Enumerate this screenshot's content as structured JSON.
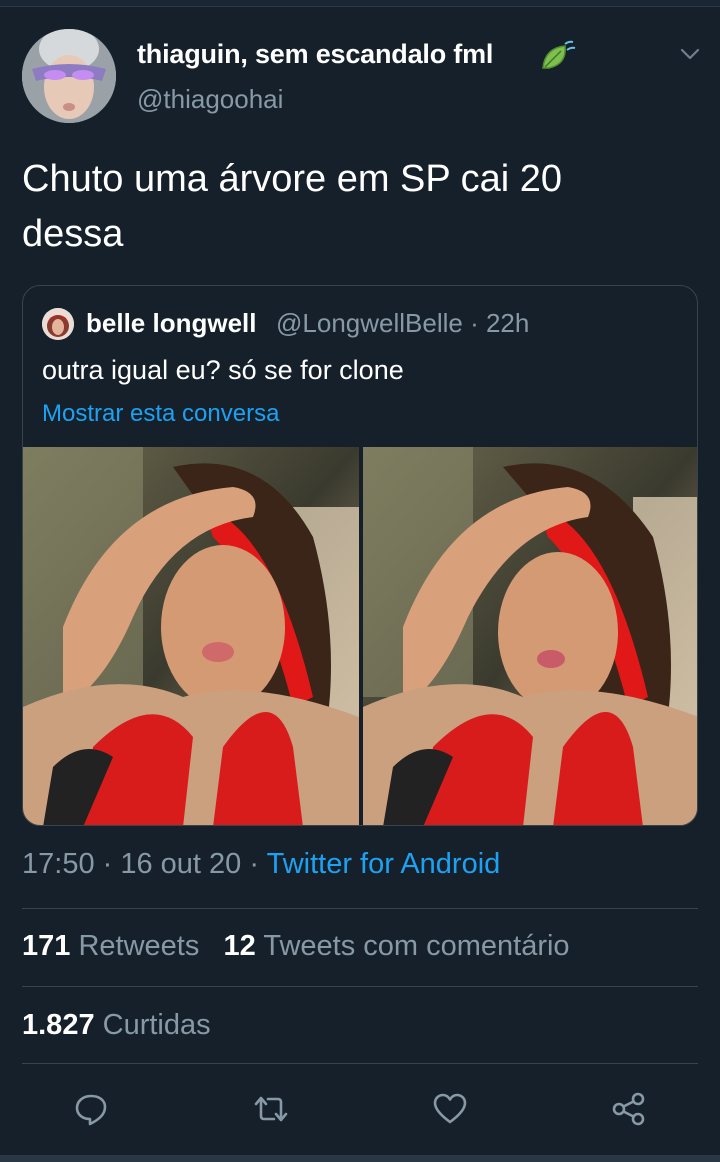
{
  "tweet": {
    "author_name": "thiaguin, sem escandalo fml",
    "author_handle": "@thiagoohai",
    "text": "Chuto uma árvore em SP cai 20 dessa",
    "time": "17:50",
    "date": "16 out 20",
    "source": "Twitter for Android",
    "retweets_count": "171",
    "retweets_label": "Retweets",
    "quotes_count": "12",
    "quotes_label": "Tweets com comentário",
    "likes_count": "1.827",
    "likes_label": "Curtidas"
  },
  "quoted": {
    "author_name": "belle longwell",
    "author_handle": "@LongwellBelle",
    "age": "22h",
    "text": "outra igual eu? só se for clone",
    "show_conversation": "Mostrar esta conversa"
  },
  "icons": {
    "author_badge": "leaf-icon",
    "menu": "chevron-down-icon",
    "reply": "reply-icon",
    "retweet": "retweet-icon",
    "like": "heart-icon",
    "share": "share-icon"
  },
  "colors": {
    "background": "#15202b",
    "accent": "#1da1f2",
    "muted": "#8899a6",
    "border": "#38444d"
  }
}
